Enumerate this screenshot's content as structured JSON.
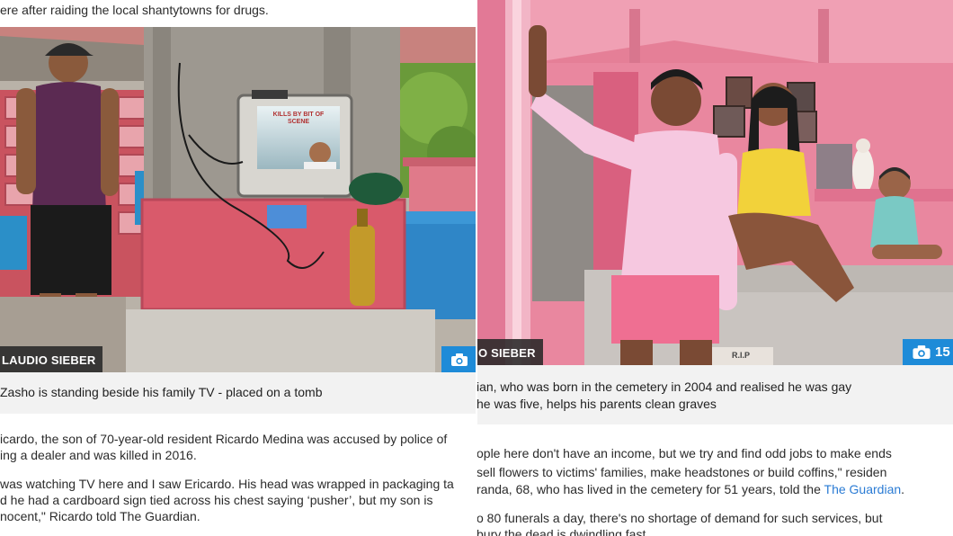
{
  "left": {
    "intro_line": "ere after raiding the local shantytowns for drugs.",
    "tv_screen_text": "KILLS BY BIT OF SCENE",
    "photo_credit": "LAUDIO SIEBER",
    "caption": "Zasho is standing beside his family TV - placed on a tomb",
    "paragraph1": [
      "icardo, the son of 70-year-old resident Ricardo Medina was accused by police of",
      "ing a dealer and was killed in 2016."
    ],
    "paragraph2": [
      "was watching TV here and I saw Ericardo. His head was wrapped in packaging ta",
      "d he had a cardboard sign tied across his chest saying ‘pusher’, but my son is",
      "nocent,\" Ricardo told The Guardian."
    ]
  },
  "right": {
    "photo_credit": "O SIEBER",
    "photo_count": "15",
    "tomb_text": "R.I.P",
    "caption": [
      "ian, who was born in the cemetery in 2004 and realised he was gay",
      "he was five, helps his parents clean graves"
    ],
    "paragraph1": {
      "line1": "ople here don't have an income, but we try and find odd jobs to make ends",
      "line2": " sell flowers to victims' families, make headstones or build coffins,\" residen",
      "line3_pre": "randa, 68, who has lived in the cemetery for 51 years, told the ",
      "line3_link": "The Guardian",
      "line3_post": "."
    },
    "paragraph2": [
      "o 80 funerals a day, there's no shortage of demand for such services, but",
      " bury the dead is dwindling fast"
    ]
  },
  "colors": {
    "camera_badge": "#1e8bd8",
    "link": "#2a7bd4",
    "caption_bg": "#f2f2f2",
    "credit_bg": "#282828"
  },
  "icons": [
    "camera-icon",
    "camera-icon"
  ]
}
